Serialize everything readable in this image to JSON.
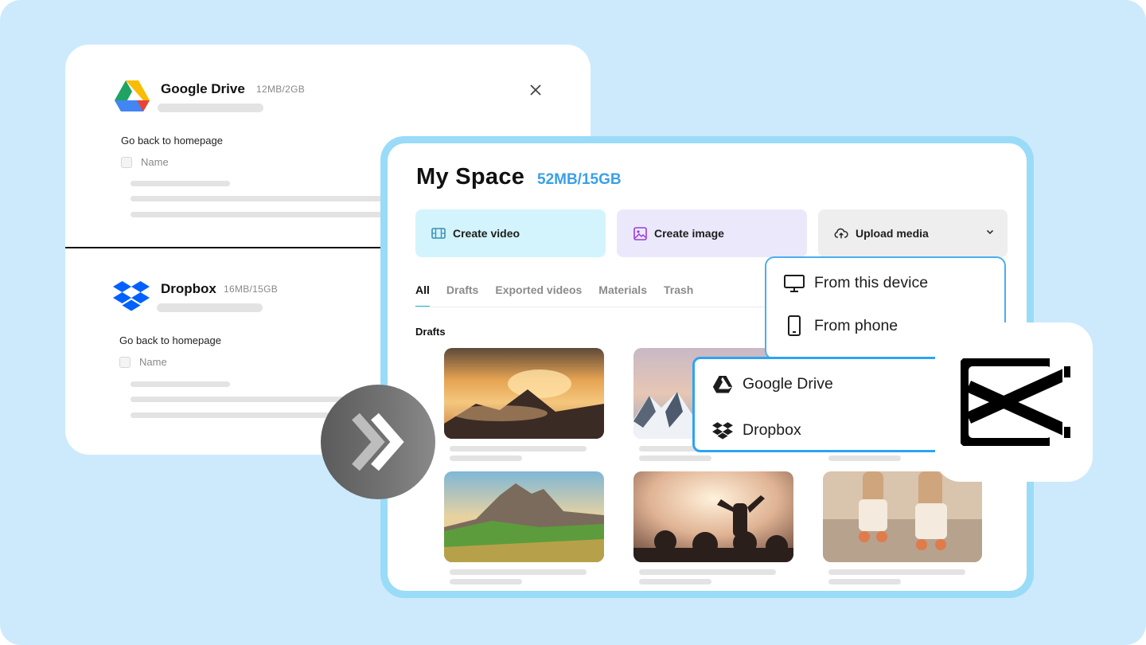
{
  "cloud_panel": {
    "google_drive": {
      "name": "Google Drive",
      "quota": "12MB/2GB",
      "back_link": "Go back to homepage",
      "name_column": "Name"
    },
    "dropbox": {
      "name": "Dropbox",
      "quota": "16MB/15GB",
      "back_link": "Go back to homepage",
      "name_column": "Name"
    }
  },
  "my_space": {
    "title": "My Space",
    "quota": "52MB/15GB",
    "actions": {
      "create_video": "Create video",
      "create_image": "Create image",
      "upload_media": "Upload media"
    },
    "tabs": [
      "All",
      "Drafts",
      "Exported videos",
      "Materials",
      "Trash"
    ],
    "active_tab": "All",
    "section_label": "Drafts",
    "thumbnails": [
      "mountain-sunrise",
      "snowy-peaks",
      "alpine-meadow",
      "concert-crowd",
      "roller-skates"
    ]
  },
  "upload_menu": {
    "from_device": "From this device",
    "from_phone": "From phone"
  },
  "cloud_menu": {
    "google_drive": "Google Drive",
    "dropbox": "Dropbox"
  },
  "colors": {
    "background": "#cdeafc",
    "accent": "#3aa0e8",
    "frame": "#9adbf8",
    "dropdown_border": "#2ea3f2"
  },
  "icons": [
    "google-drive-icon",
    "dropbox-icon",
    "close-icon",
    "forward-arrow-icon",
    "video-icon",
    "image-icon",
    "cloud-upload-icon",
    "chevron-down-icon",
    "monitor-icon",
    "phone-icon",
    "capcut-logo"
  ]
}
